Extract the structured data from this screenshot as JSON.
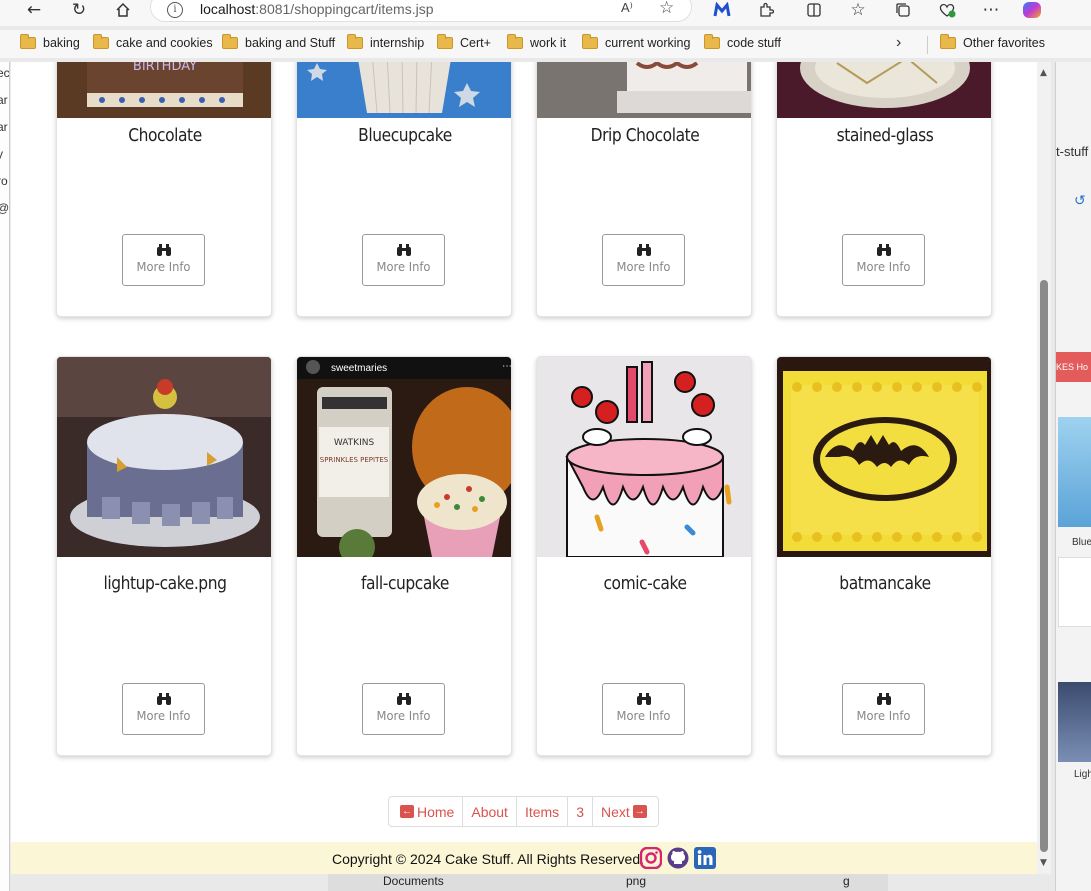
{
  "browser": {
    "url_host": "localhost",
    "url_rest": ":8081/shoppingcart/items.jsp",
    "read_aloud": "A⁾"
  },
  "bookmarks": [
    "baking",
    "cake and cookies",
    "baking and Stuff",
    "internship",
    "Cert+",
    "work it",
    "current working",
    "code stuff"
  ],
  "other_favorites": "Other favorites",
  "left_window_glyphs": [
    "ec",
    "ar",
    "ar",
    "y",
    "ro",
    "@",
    "",
    "",
    "",
    "",
    ""
  ],
  "right_window": {
    "tab_text": "t-stuff",
    "nav_text": "KES  Ho",
    "label1": "Bluec",
    "label2": "Ligh"
  },
  "taskbar": {
    "item1": "Documents",
    "item2": "png",
    "item3": "g"
  },
  "more_info_label": "More Info",
  "cards": [
    {
      "name": "Chocolate"
    },
    {
      "name": "Bluecupcake"
    },
    {
      "name": "Drip Chocolate"
    },
    {
      "name": "stained-glass"
    },
    {
      "name": "lightup-cake.png"
    },
    {
      "name": "fall-cupcake",
      "img_caption": "sweetmaries"
    },
    {
      "name": "comic-cake"
    },
    {
      "name": "batmancake"
    }
  ],
  "fall_cupcake_jar": {
    "brand": "WATKINS",
    "label": "SPRINKLES PEPITES"
  },
  "cake_topper_text": "BIRTHDAY",
  "pagination": {
    "home": "Home",
    "about": "About",
    "items": "Items",
    "page": "3",
    "next": "Next"
  },
  "footer": {
    "copyright": "Copyright © 2024 Cake Stuff. All Rights Reserved."
  }
}
